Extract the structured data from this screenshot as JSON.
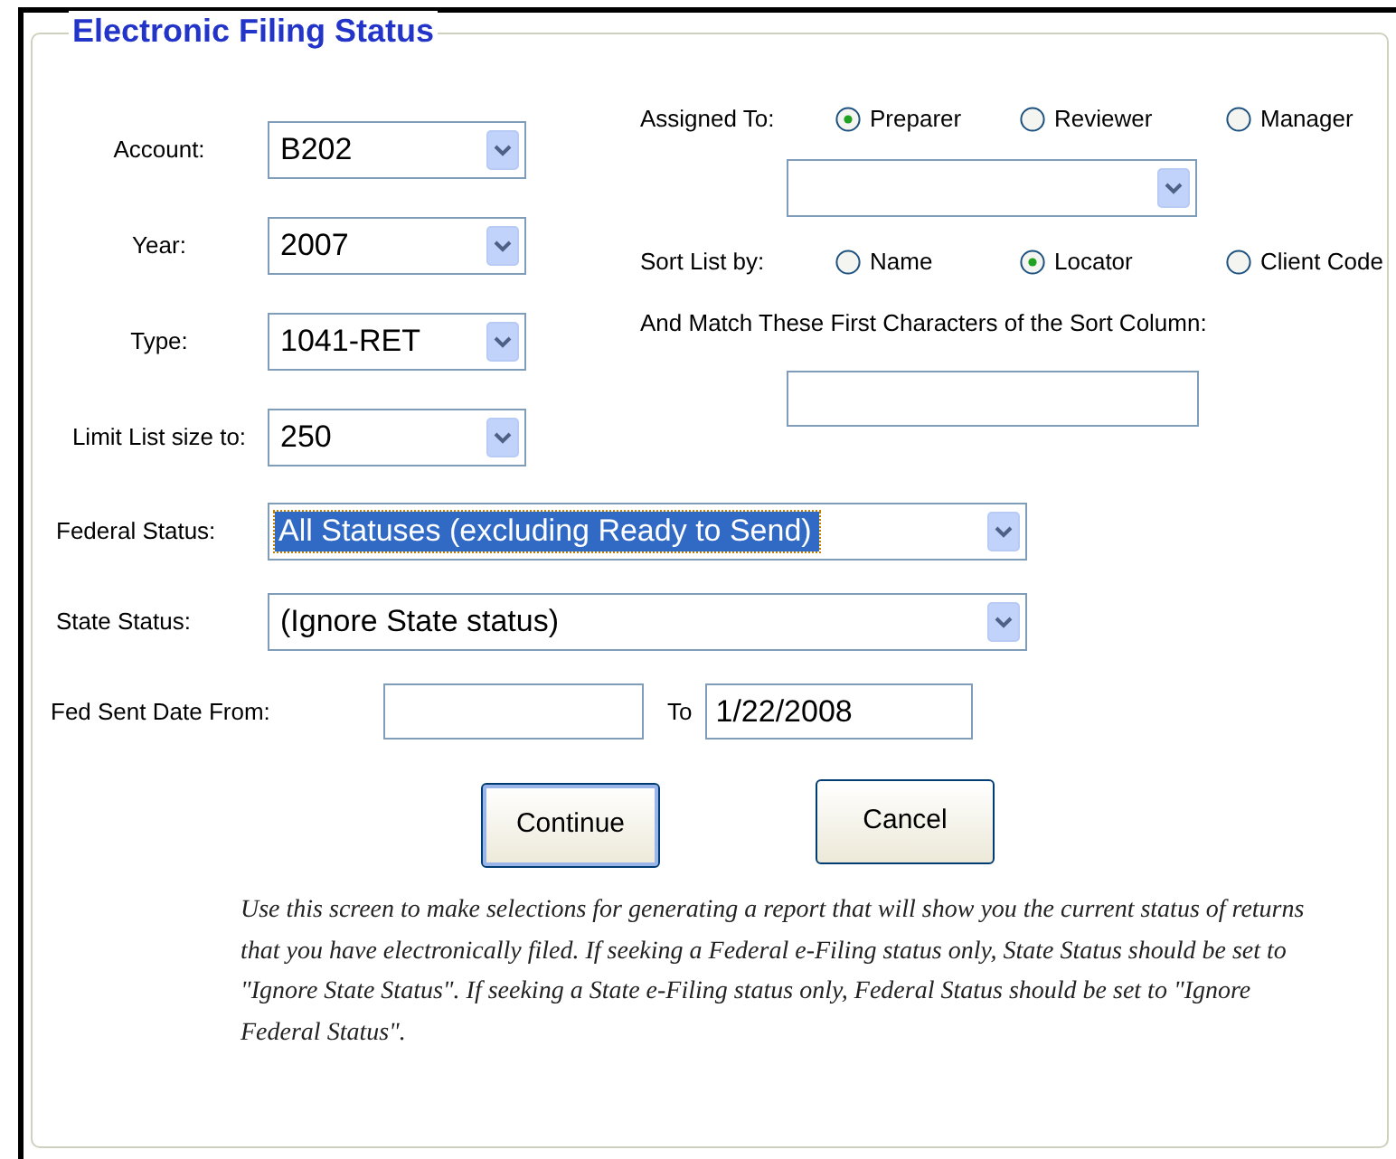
{
  "title": "Electronic Filing Status",
  "left_fields": [
    {
      "label": "Account:",
      "value": "B202"
    },
    {
      "label": "Year:",
      "value": "2007"
    },
    {
      "label": "Type:",
      "value": "1041-RET"
    },
    {
      "label": "Limit List size to:",
      "value": "250"
    }
  ],
  "assigned_to": {
    "label": "Assigned To:",
    "options": [
      {
        "label": "Preparer",
        "selected": true
      },
      {
        "label": "Reviewer",
        "selected": false
      },
      {
        "label": "Manager",
        "selected": false
      }
    ]
  },
  "sort_list": {
    "label": "Sort List by:",
    "options": [
      {
        "label": "Name",
        "selected": false
      },
      {
        "label": "Locator",
        "selected": true
      },
      {
        "label": "Client Code",
        "selected": false
      }
    ]
  },
  "match": {
    "label": "And Match These First Characters of the Sort Column:"
  },
  "federal_status": {
    "label": "Federal Status:",
    "value": "All Statuses (excluding Ready to Send)",
    "focused": true
  },
  "state_status": {
    "label": "State Status:",
    "value": "(Ignore State status)",
    "focused": false
  },
  "date_range": {
    "from_label": "Fed Sent Date From:",
    "to_label": "To",
    "to_value": "1/22/2008"
  },
  "buttons": [
    {
      "label": "Continue",
      "default": true
    },
    {
      "label": "Cancel",
      "default": false
    }
  ],
  "note": "Use this screen to make selections for generating a report that will show you the current status of returns that you have electronically filed. If seeking a Federal e-Filing status only, State Status should be set to \"Ignore State Status\". If seeking a State e-Filing status only, Federal Status should be set to \"Ignore Federal Status\"."
}
